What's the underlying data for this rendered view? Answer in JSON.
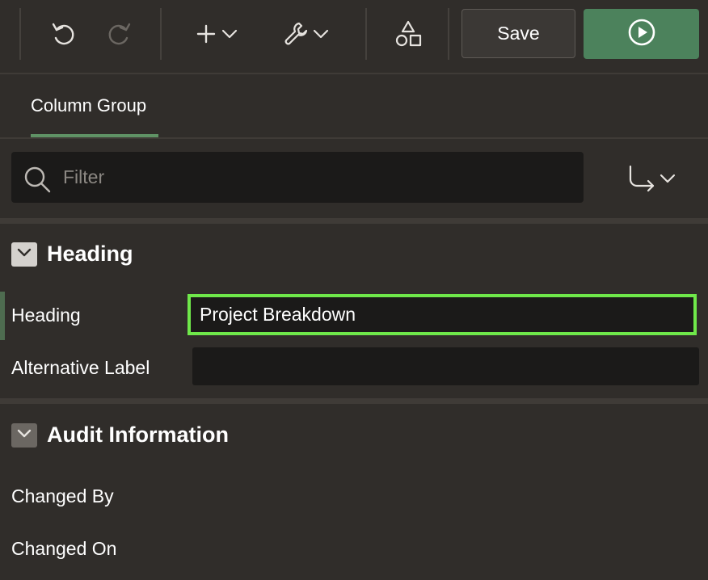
{
  "toolbar": {
    "undo_icon": "undo-icon",
    "redo_icon": "redo-icon",
    "create_icon": "plus-icon",
    "utilities_icon": "wrench-icon",
    "shared_components_icon": "shapes-icon",
    "save_label": "Save",
    "run_icon": "play-circle-icon",
    "colors": {
      "run_background": "#4c825c"
    }
  },
  "tabs": [
    {
      "label": "Column Group",
      "active": true
    }
  ],
  "filter": {
    "placeholder": "Filter",
    "goto_icon": "go-to-group-icon"
  },
  "sections": [
    {
      "title": "Heading",
      "expanded": true,
      "properties": [
        {
          "label": "Heading",
          "value": "Project Breakdown"
        },
        {
          "label": "Alternative Label",
          "value": ""
        }
      ]
    },
    {
      "title": "Audit Information",
      "expanded": true,
      "properties": [
        {
          "label": "Changed By",
          "value": ""
        },
        {
          "label": "Changed On",
          "value": ""
        }
      ]
    }
  ],
  "colors": {
    "background": "#302d2a",
    "input_background": "#1b1a19",
    "focus_outline": "#6fe84a",
    "tab_underline": "#5f9265"
  }
}
